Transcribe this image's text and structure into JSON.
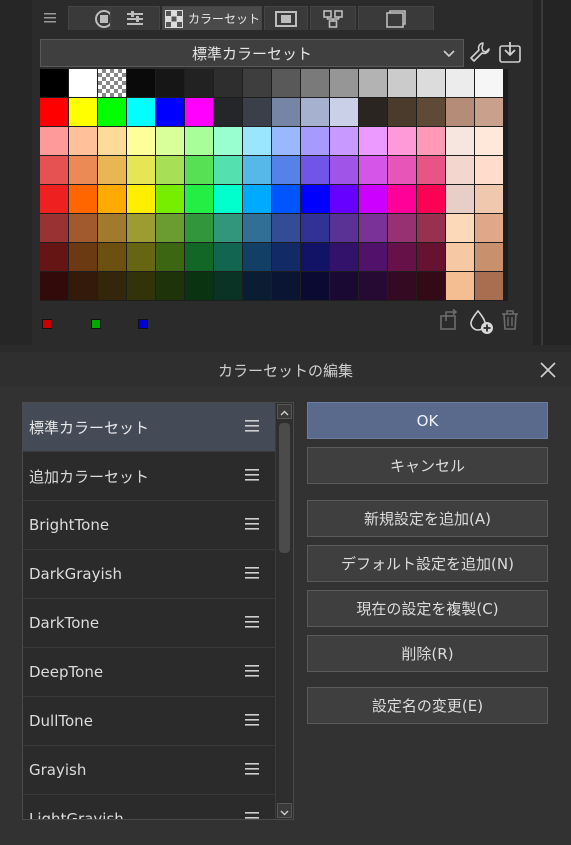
{
  "palette_panel": {
    "active_tab_label": "カラーセット",
    "selected_set": "標準カラーセット",
    "swatches": [
      [
        "#000000",
        "#ffffff",
        "checker",
        "#0a0a0a",
        "#161616",
        "#222222",
        "#2e2e2e",
        "#3e3e3e",
        "#595959",
        "#7a7a7a",
        "#969696",
        "#b3b3b3",
        "#cbcbcb",
        "#dcdcdc",
        "#ececec",
        "#f6f6f6"
      ],
      [
        "#ff0000",
        "#ffff00",
        "#00ff00",
        "#00ffff",
        "#0000ff",
        "#ff00ff",
        "#24262a",
        "#3a3f4a",
        "#7684a6",
        "#a6b0cf",
        "#c9d0e8",
        "#2a2520",
        "#4a3b2c",
        "#5e4a36",
        "#b48c78",
        "#c8a08c"
      ],
      [
        "#ff9a9a",
        "#ffc09a",
        "#ffdb9a",
        "#ffff9a",
        "#d8ff9a",
        "#a8ff9a",
        "#9affd0",
        "#9ae6ff",
        "#9ab8ff",
        "#a79aff",
        "#c89aff",
        "#ec9aff",
        "#ff9ad8",
        "#ff9ab6",
        "#f7e6df",
        "#ffe7d9"
      ],
      [
        "#e55252",
        "#eb8a55",
        "#e8b653",
        "#e6e655",
        "#a8e055",
        "#58e055",
        "#55e0b0",
        "#55b8e8",
        "#5581e8",
        "#7055e8",
        "#a055e8",
        "#d455e8",
        "#e855b8",
        "#e85585",
        "#f3d7cf",
        "#ffdccb"
      ],
      [
        "#ee2020",
        "#ff6600",
        "#ffaa00",
        "#ffee00",
        "#77ee00",
        "#22ee44",
        "#00ffcc",
        "#00aaff",
        "#0055ff",
        "#0000ff",
        "#6600ff",
        "#cc00ff",
        "#ff0099",
        "#ff0055",
        "#e7cfc8",
        "#f0c8ad"
      ],
      [
        "#993333",
        "#a05a2d",
        "#a07a2d",
        "#9c9c32",
        "#6a9c32",
        "#32963c",
        "#32967a",
        "#326f96",
        "#324c96",
        "#323296",
        "#5a3296",
        "#7a3296",
        "#963272",
        "#963250",
        "#fbd9b9",
        "#e0a888"
      ],
      [
        "#661515",
        "#6b3a12",
        "#6b5012",
        "#666612",
        "#3d6612",
        "#126626",
        "#126650",
        "#123f66",
        "#122a66",
        "#121266",
        "#33126b",
        "#50126b",
        "#661248",
        "#661230",
        "#f7c8a4",
        "#c8906c"
      ],
      [
        "#330a0a",
        "#331a0a",
        "#33260a",
        "#33330a",
        "#1e330a",
        "#0a3312",
        "#0a3326",
        "#0a1e33",
        "#0a1433",
        "#0a0a33",
        "#1a0a33",
        "#260a33",
        "#330a22",
        "#330a16",
        "#f4bd92",
        "#a86e50"
      ]
    ],
    "recent_colors": [
      "#cc0000",
      "#00aa00",
      "#0000dd"
    ]
  },
  "dialog": {
    "title": "カラーセットの編集",
    "list": [
      {
        "label": "標準カラーセット",
        "selected": true
      },
      {
        "label": "追加カラーセット",
        "selected": false
      },
      {
        "label": "BrightTone",
        "selected": false
      },
      {
        "label": "DarkGrayish",
        "selected": false
      },
      {
        "label": "DarkTone",
        "selected": false
      },
      {
        "label": "DeepTone",
        "selected": false
      },
      {
        "label": "DullTone",
        "selected": false
      },
      {
        "label": "Grayish",
        "selected": false
      },
      {
        "label": "LightGrayish",
        "selected": false
      }
    ],
    "buttons": {
      "ok": "OK",
      "cancel": "キャンセル",
      "add_new": "新規設定を追加(A)",
      "add_default": "デフォルト設定を追加(N)",
      "duplicate": "現在の設定を複製(C)",
      "delete": "削除(R)",
      "rename": "設定名の変更(E)"
    }
  }
}
